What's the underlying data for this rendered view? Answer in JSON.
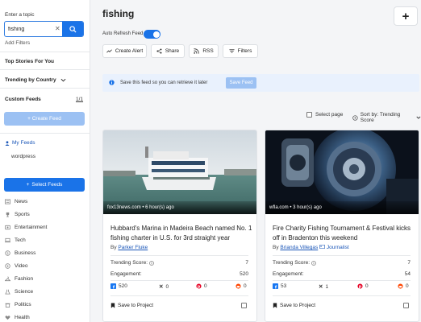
{
  "sidebar": {
    "topic_label": "Enter a topic",
    "search_value": "fishing",
    "add_filters": "Add Filters",
    "top_stories": "Top Stories For You",
    "trending": "Trending by Country",
    "custom_feeds": "Custom Feeds",
    "custom_count": "1/1",
    "create_feed": "+ Create Feed",
    "my_feeds": "My Feeds",
    "feed_item": "wordpress",
    "select_feeds": "Select Feeds",
    "categories": [
      "News",
      "Sports",
      "Entertainment",
      "Tech",
      "Business",
      "Video",
      "Fashion",
      "Science",
      "Politics",
      "Health"
    ]
  },
  "main": {
    "title": "fishing",
    "auto_refresh": "Auto Refresh Feed",
    "auto_refresh_on": true,
    "buttons": {
      "create_alert": "Create Alert",
      "share": "Share",
      "rss": "RSS",
      "filters": "Filters"
    },
    "banner_text": "Save this feed so you can retrieve it later",
    "banner_btn": "Save Feed",
    "select_page": "Select page",
    "sort_by": "Sort by: Trending Score"
  },
  "cards": [
    {
      "source": "fox13news.com • 6 hour(s) ago",
      "title": "Hubbard's Marina in Madeira Beach named No. 1 fishing charter in U.S. for 3rd straight year",
      "by_prefix": "By",
      "author": "Parker Fluke",
      "author_role": "",
      "trending_label": "Trending Score:",
      "trending": "7",
      "engagement_label": "Engagement:",
      "engagement": "520",
      "facebook": "520",
      "x": "0",
      "pinterest": "0",
      "reddit": "0",
      "save": "Save to Project"
    },
    {
      "source": "wfla.com • 3 hour(s) ago",
      "title": "Fire Charity Fishing Tournament & Festival kicks off in Bradenton this weekend",
      "by_prefix": "By",
      "author": "Brianda Villegas",
      "author_role": "Journalist",
      "trending_label": "Trending Score:",
      "trending": "7",
      "engagement_label": "Engagement:",
      "engagement": "54",
      "facebook": "53",
      "x": "1",
      "pinterest": "0",
      "reddit": "0",
      "save": "Save to Project"
    }
  ],
  "colors": {
    "accent": "#1a73e8",
    "accent_light": "#9cc1f3",
    "banner_bg": "#e9f1fd"
  }
}
